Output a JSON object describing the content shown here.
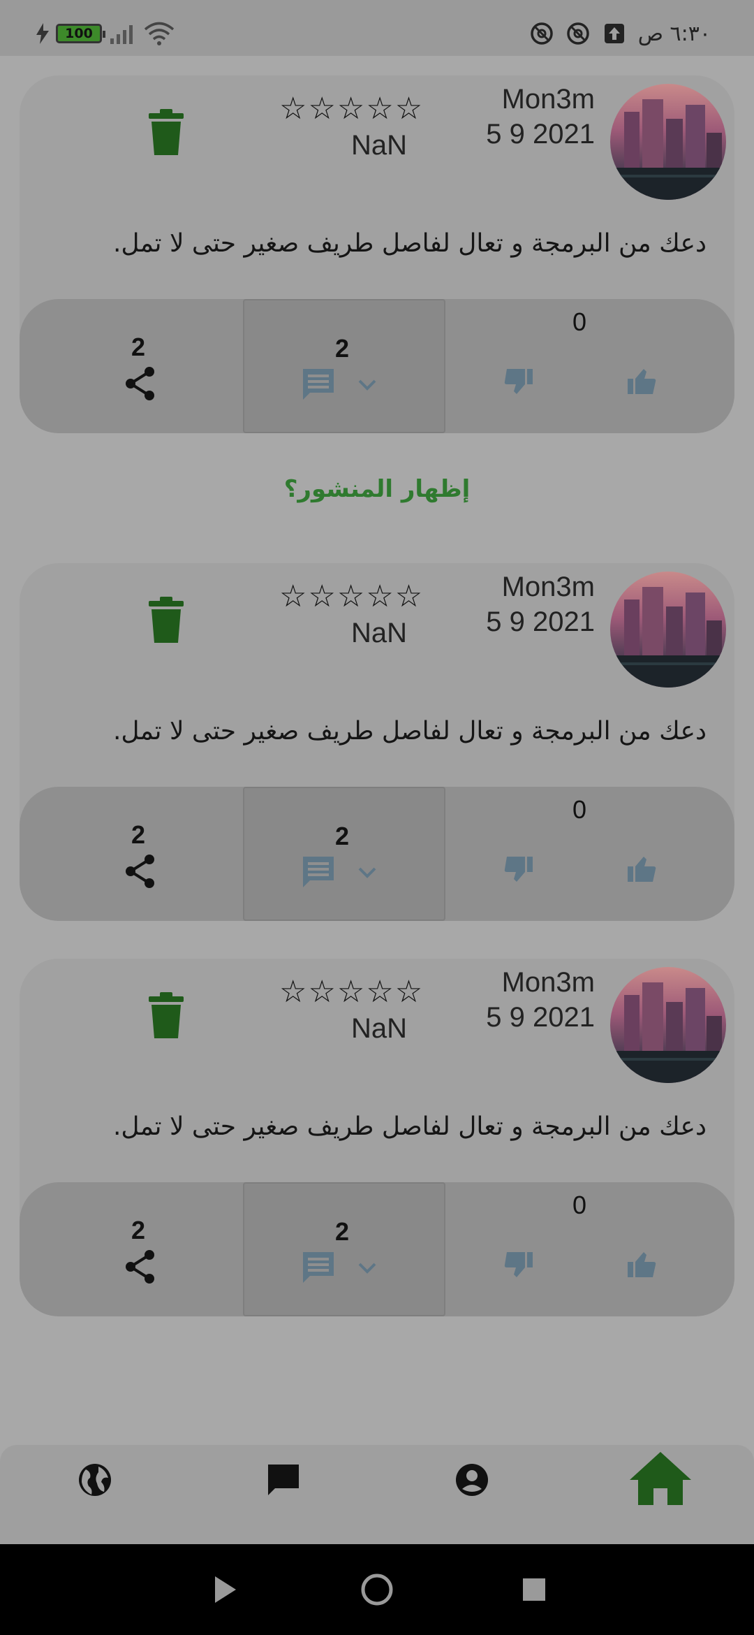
{
  "status_bar": {
    "time": "٦:٣٠ ص",
    "battery": "100"
  },
  "posts": [
    {
      "author": "Mon3m",
      "date": "5 9 2021",
      "stars": "☆☆☆☆☆",
      "rating": "NaN",
      "text": "دعك من البرمجة و تعال لفاصل طريف صغير حتى لا تمل.",
      "likes": "0",
      "comments": "2",
      "shares": "2"
    },
    {
      "author": "Mon3m",
      "date": "5 9 2021",
      "stars": "☆☆☆☆☆",
      "rating": "NaN",
      "text": "دعك من البرمجة و تعال لفاصل طريف صغير حتى لا تمل.",
      "likes": "0",
      "comments": "2",
      "shares": "2"
    },
    {
      "author": "Mon3m",
      "date": "5 9 2021",
      "stars": "☆☆☆☆☆",
      "rating": "NaN",
      "text": "دعك من البرمجة و تعال لفاصل طريف صغير حتى لا تمل.",
      "likes": "0",
      "comments": "2",
      "shares": "2"
    }
  ],
  "show_post_label": "إظهار المنشور؟",
  "nav": {
    "items": [
      "globe-icon",
      "chat-icon",
      "account-icon",
      "home-icon"
    ],
    "active": "home-icon",
    "active_color": "#1f5a1a"
  },
  "colors": {
    "accent": "#2f7a2f",
    "delete": "#1f5a1a",
    "icon_muted": "#5e7686"
  }
}
